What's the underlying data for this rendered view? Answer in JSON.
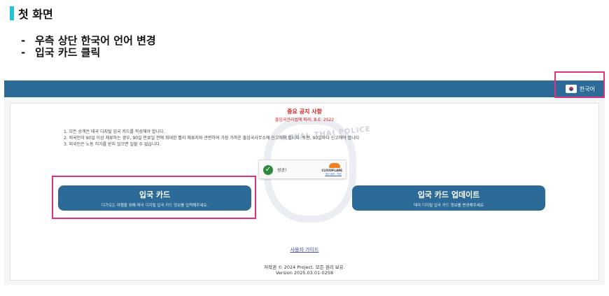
{
  "guide": {
    "title": "첫 화면",
    "steps": [
      "우측 상단 한국어 언어 변경",
      "입국 카드 클릭"
    ],
    "accent_color": "#22c3d9",
    "highlight_color": "#e0317e"
  },
  "topbar": {
    "language_label": "한국어",
    "flag_icon": "korea-flag-icon",
    "color": "#2c6b97"
  },
  "watermark": {
    "text": "ROYAL THAI POLICE"
  },
  "notice": {
    "title": "중요 공지 사항",
    "subtitle": "출입국관리법에 따라, B.E. 2522",
    "items": [
      "1. 모든 승객은 태국 디지털 입국 카드를 작성해야 합니다.",
      "2. 외국인이 90일 이상 체류하는 경우, 90일 만료일 전에 최대한 빨리 체류지와 관련하여 가장 가까운 출입국사무소에 신고해야 합니다. 또한, 90일마다 신고해야 합니다",
      "3. 외국인은 노동 허가를 받지 않으면 일할 수 없습니다."
    ]
  },
  "captcha": {
    "status": "성공!",
    "brand": "CLOUDFLARE",
    "links": "개인 정보 · 약관"
  },
  "buttons": {
    "entry": {
      "label": "입국 카드",
      "description": "디가오는 여행을 위해 태국 디지털 입국 카드 정보를 입력해주세요."
    },
    "update": {
      "label": "입국 카드 업데이트",
      "description": "태국 디지털 입국 카드 정보를 변경해주세요"
    }
  },
  "footer": {
    "guide_link": "사용자 가이드",
    "copyright": "저작권 © 2024 Project. 모든 권리 보유.",
    "version": "Version 2025.03.01-0258"
  }
}
